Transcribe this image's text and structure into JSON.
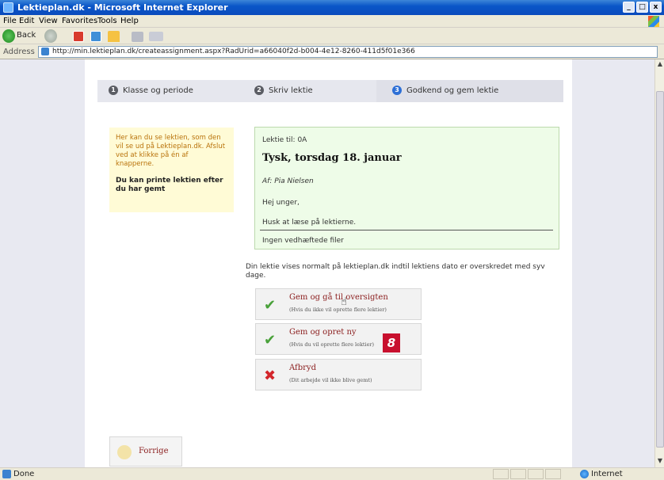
{
  "window": {
    "title": "Lektieplan.dk - Microsoft Internet Explorer",
    "controls": [
      "_",
      "□",
      "x"
    ]
  },
  "menu": [
    "File",
    "Edit",
    "View",
    "Favorites",
    "Tools",
    "Help"
  ],
  "toolbar": {
    "back_label": "Back"
  },
  "address": {
    "label": "Address",
    "url": "http://min.lektieplan.dk/createassignment.aspx?RadUrid=a66040f2d-b004-4e12-8260-411d5f01e366"
  },
  "steps": [
    {
      "num": "1",
      "label": "Klasse og periode"
    },
    {
      "num": "2",
      "label": "Skriv lektie"
    },
    {
      "num": "3",
      "label": "Godkend og gem lektie"
    }
  ],
  "info": {
    "text": "Her kan du se lektien, som den vil se ud på Lektieplan.dk. Afslut ved at klikke på én af knapperne.",
    "bold": "Du kan printe lektien efter du har gemt"
  },
  "lesson": {
    "to": "Lektie til: 0A",
    "title": "Tysk, torsdag 18. januar",
    "author": "Af: Pia Nielsen",
    "greeting": "Hej unger,",
    "body": "Husk at læse på lektierne.",
    "files": "Ingen vedhæftede filer"
  },
  "note": "Din lektie vises normalt på lektieplan.dk indtil lektiens dato er overskredet med syv dage.",
  "actions": {
    "save_overview": {
      "label": "Gem og gå til oversigten",
      "sub": "(Hvis du ikke vil oprette flere lektier)"
    },
    "save_new": {
      "label": "Gem og opret ny",
      "sub": "(Hvis du vil oprette flere lektier)"
    },
    "cancel": {
      "label": "Afbryd",
      "sub": "(Dit arbejde vil ikke blive gemt)"
    }
  },
  "badge": "8",
  "prev": {
    "label": "Forrige"
  },
  "status": {
    "left": "Done",
    "zone": "Internet"
  },
  "colors": {
    "steps_bg": "#e6e7ee",
    "info_bg": "#fffbd6",
    "preview_bg": "#eefce8",
    "preview_border": "#bcd9ad",
    "link_red": "#8b1e1e",
    "badge_red": "#c8102e"
  }
}
